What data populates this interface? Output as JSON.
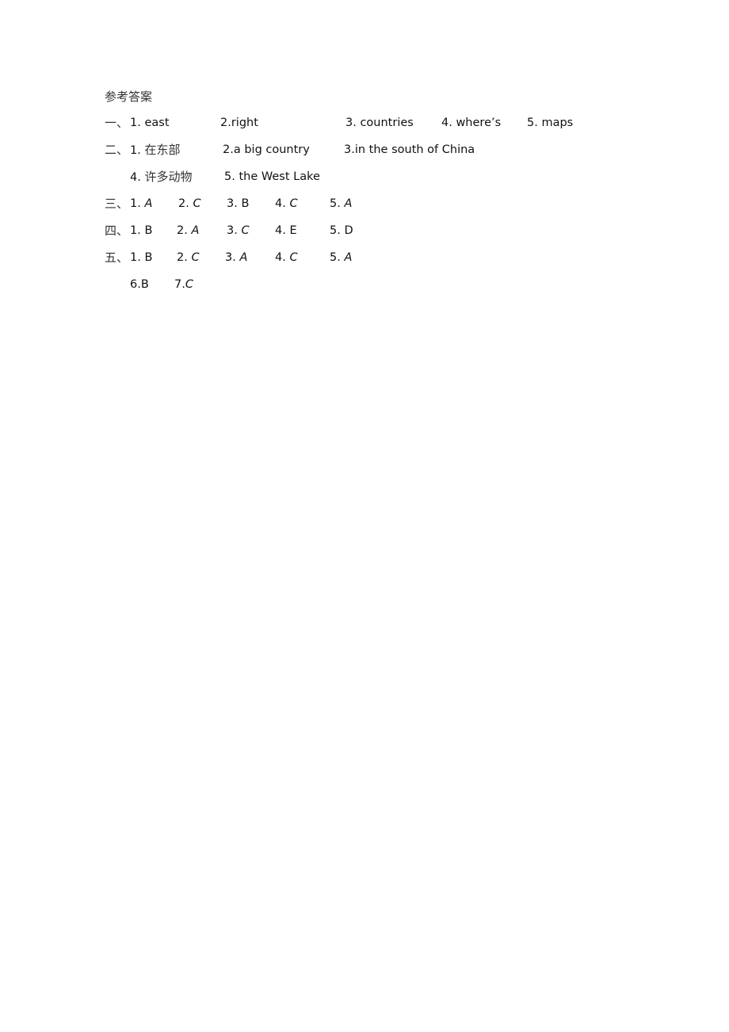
{
  "title": "参考答案",
  "sections": [
    {
      "marker": "一、",
      "rows": [
        [
          {
            "num": "1.",
            "answer": "east"
          },
          {
            "num": "2.",
            "answer": "right"
          },
          {
            "num": "3.",
            "answer": "countries"
          },
          {
            "num": "4.",
            "answer": "where’s"
          },
          {
            "num": "5.",
            "answer": "maps"
          }
        ]
      ]
    },
    {
      "marker": "二、",
      "rows": [
        [
          {
            "num": "1.",
            "answer": "在东部"
          },
          {
            "num": "2.",
            "answer": "a big country"
          },
          {
            "num": "3.",
            "answer": "in the south of China"
          }
        ],
        [
          {
            "num": "4.",
            "answer": "许多动物"
          },
          {
            "num": "5.",
            "answer": "the West Lake"
          }
        ]
      ]
    },
    {
      "marker": "三、",
      "rows": [
        [
          {
            "num": "1.",
            "answer": "A"
          },
          {
            "num": "2.",
            "answer": "C"
          },
          {
            "num": "3.",
            "answer": "B"
          },
          {
            "num": "4.",
            "answer": "C"
          },
          {
            "num": "5.",
            "answer": "A"
          }
        ]
      ]
    },
    {
      "marker": "四、",
      "rows": [
        [
          {
            "num": "1.",
            "answer": "B"
          },
          {
            "num": "2.",
            "answer": "A"
          },
          {
            "num": "3.",
            "answer": "C"
          },
          {
            "num": "4.",
            "answer": "E"
          },
          {
            "num": "5.",
            "answer": "D"
          }
        ]
      ]
    },
    {
      "marker": "五、",
      "rows": [
        [
          {
            "num": "1.",
            "answer": "B"
          },
          {
            "num": "2.",
            "answer": "C"
          },
          {
            "num": "3.",
            "answer": "A"
          },
          {
            "num": "4.",
            "answer": "C"
          },
          {
            "num": "5.",
            "answer": "A"
          }
        ],
        [
          {
            "num": "6.",
            "answer": "B"
          },
          {
            "num": "7.",
            "answer": "C"
          }
        ]
      ]
    }
  ]
}
